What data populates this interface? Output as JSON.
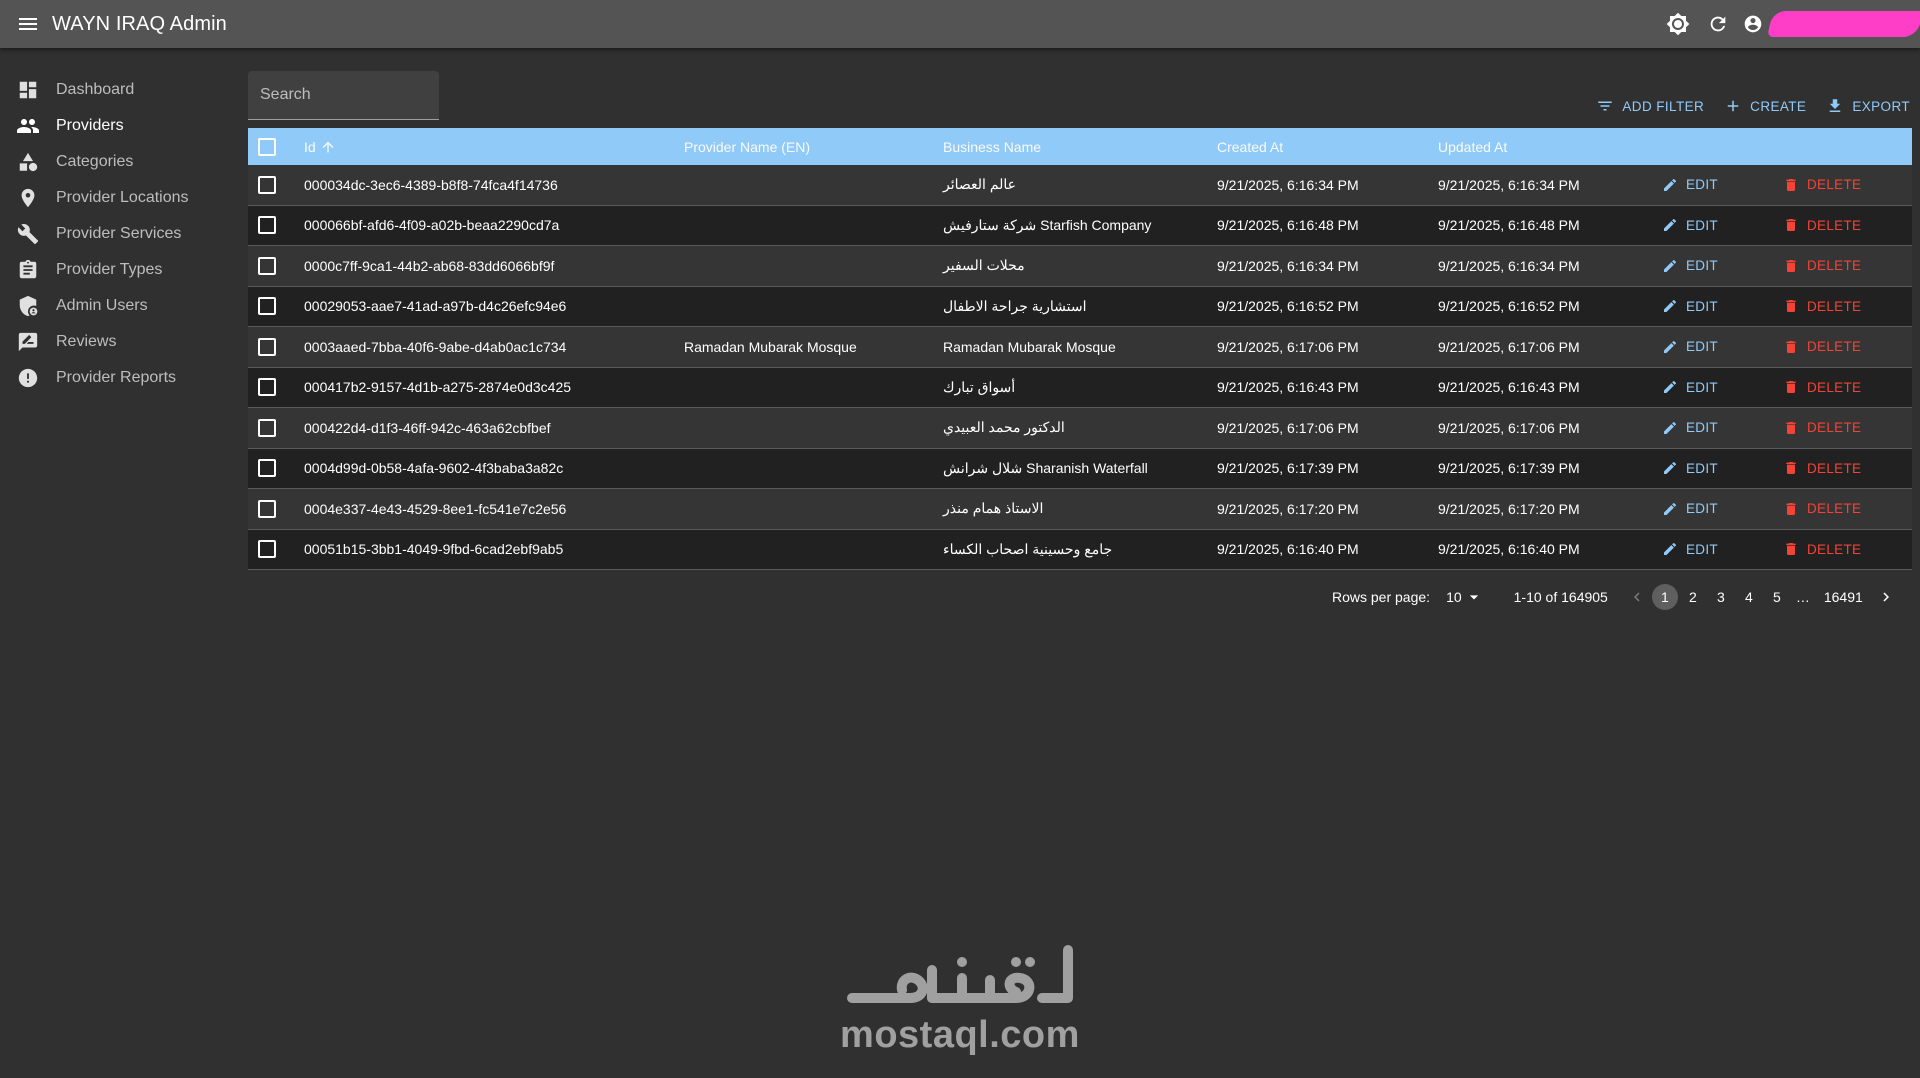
{
  "appbar": {
    "title": "WAYN IRAQ Admin",
    "icons": [
      "menu-icon",
      "theme-brightness-icon",
      "refresh-icon",
      "account-circle-icon"
    ]
  },
  "sidebar": {
    "items": [
      {
        "label": "Dashboard",
        "icon": "dashboard-icon",
        "active": false
      },
      {
        "label": "Providers",
        "icon": "people-icon",
        "active": true
      },
      {
        "label": "Categories",
        "icon": "category-icon",
        "active": false
      },
      {
        "label": "Provider Locations",
        "icon": "location-pin-icon",
        "active": false
      },
      {
        "label": "Provider Services",
        "icon": "wrench-icon",
        "active": false
      },
      {
        "label": "Provider Types",
        "icon": "assignment-icon",
        "active": false
      },
      {
        "label": "Admin Users",
        "icon": "admin-shield-icon",
        "active": false
      },
      {
        "label": "Reviews",
        "icon": "rate-review-icon",
        "active": false
      },
      {
        "label": "Provider Reports",
        "icon": "report-icon",
        "active": false
      }
    ]
  },
  "search": {
    "placeholder": "Search"
  },
  "toolbar": {
    "add_filter": "ADD FILTER",
    "create": "CREATE",
    "export": "EXPORT"
  },
  "table": {
    "columns": [
      "Id",
      "Provider Name (EN)",
      "Business Name",
      "Created At",
      "Updated At"
    ],
    "sort_column": "Id",
    "sort_direction": "ascending",
    "edit_label": "EDIT",
    "delete_label": "DELETE",
    "rows": [
      {
        "id": "000034dc-3ec6-4389-b8f8-74fca4f14736",
        "name_en": "",
        "business": "عالم العصائر",
        "created": "9/21/2025, 6:16:34 PM",
        "updated": "9/21/2025, 6:16:34 PM"
      },
      {
        "id": "000066bf-afd6-4f09-a02b-beaa2290cd7a",
        "name_en": "",
        "business": "شركة ستارفيش Starfish Company",
        "created": "9/21/2025, 6:16:48 PM",
        "updated": "9/21/2025, 6:16:48 PM"
      },
      {
        "id": "0000c7ff-9ca1-44b2-ab68-83dd6066bf9f",
        "name_en": "",
        "business": "محلات السفير",
        "created": "9/21/2025, 6:16:34 PM",
        "updated": "9/21/2025, 6:16:34 PM"
      },
      {
        "id": "00029053-aae7-41ad-a97b-d4c26efc94e6",
        "name_en": "",
        "business": "استشارية جراحة الاطفال",
        "created": "9/21/2025, 6:16:52 PM",
        "updated": "9/21/2025, 6:16:52 PM"
      },
      {
        "id": "0003aaed-7bba-40f6-9abe-d4ab0ac1c734",
        "name_en": "Ramadan Mubarak Mosque",
        "business": "Ramadan Mubarak Mosque",
        "created": "9/21/2025, 6:17:06 PM",
        "updated": "9/21/2025, 6:17:06 PM"
      },
      {
        "id": "000417b2-9157-4d1b-a275-2874e0d3c425",
        "name_en": "",
        "business": "أسواق تبارك",
        "created": "9/21/2025, 6:16:43 PM",
        "updated": "9/21/2025, 6:16:43 PM"
      },
      {
        "id": "000422d4-d1f3-46ff-942c-463a62cbfbef",
        "name_en": "",
        "business": "الدكتور محمد العبيدي",
        "created": "9/21/2025, 6:17:06 PM",
        "updated": "9/21/2025, 6:17:06 PM"
      },
      {
        "id": "0004d99d-0b58-4afa-9602-4f3baba3a82c",
        "name_en": "",
        "business": "شلال شرانش Sharanish Waterfall",
        "created": "9/21/2025, 6:17:39 PM",
        "updated": "9/21/2025, 6:17:39 PM"
      },
      {
        "id": "0004e337-4e43-4529-8ee1-fc541e7c2e56",
        "name_en": "",
        "business": "الاستاذ همام منذر",
        "created": "9/21/2025, 6:17:20 PM",
        "updated": "9/21/2025, 6:17:20 PM"
      },
      {
        "id": "00051b15-3bb1-4049-9fbd-6cad2ebf9ab5",
        "name_en": "",
        "business": "جامع وحسينية اصحاب الكساء",
        "created": "9/21/2025, 6:16:40 PM",
        "updated": "9/21/2025, 6:16:40 PM"
      }
    ]
  },
  "pagination": {
    "rows_per_page_label": "Rows per page:",
    "rows_per_page": "10",
    "range": "1-10 of 164905",
    "pages": [
      "1",
      "2",
      "3",
      "4",
      "5"
    ],
    "ellipsis": "…",
    "last_page": "16491",
    "current_page": "1"
  },
  "watermark": {
    "arabic": "مستقل",
    "latin": "mostaql.com"
  },
  "colors": {
    "appbar": "#545454",
    "background": "#303030",
    "header_row": "#90caf9",
    "accent": "#90caf9",
    "danger": "#f44336",
    "redaction": "#ff3ec8"
  }
}
